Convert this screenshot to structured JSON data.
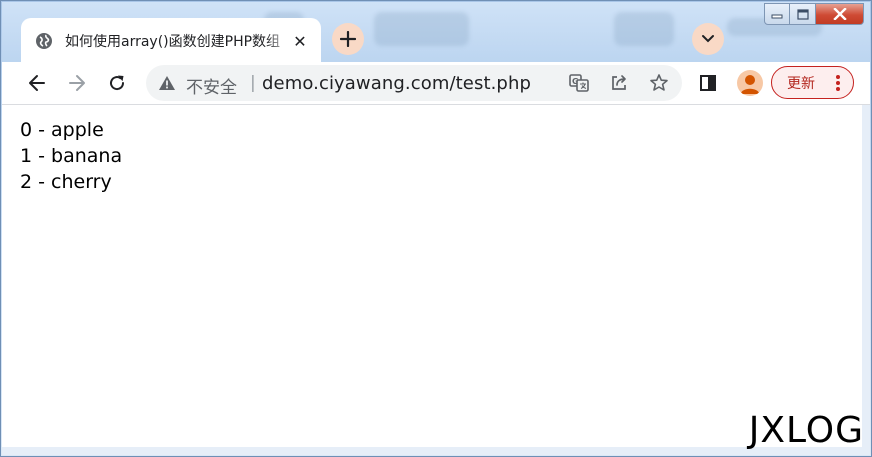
{
  "tab": {
    "title": "如何使用array()函数创建PHP数组",
    "close_glyph": "✕",
    "new_tab_glyph": "+"
  },
  "window_controls": [
    "minimize",
    "maximize",
    "close"
  ],
  "toolbar": {
    "back_icon": "back-arrow-icon",
    "forward_icon": "forward-arrow-icon",
    "reload_icon": "reload-icon",
    "security_label": "不安全",
    "separator": "|",
    "url": "demo.ciyawang.com/test.php",
    "update_label": "更新"
  },
  "page": {
    "lines": [
      "0 - apple",
      "1 - banana",
      "2 - cherry"
    ]
  },
  "watermark": "JXLOG",
  "colors": {
    "accent_update": "#c5221f",
    "tab_circle": "#f9d9c6",
    "avatar": "#f7c8a5"
  }
}
